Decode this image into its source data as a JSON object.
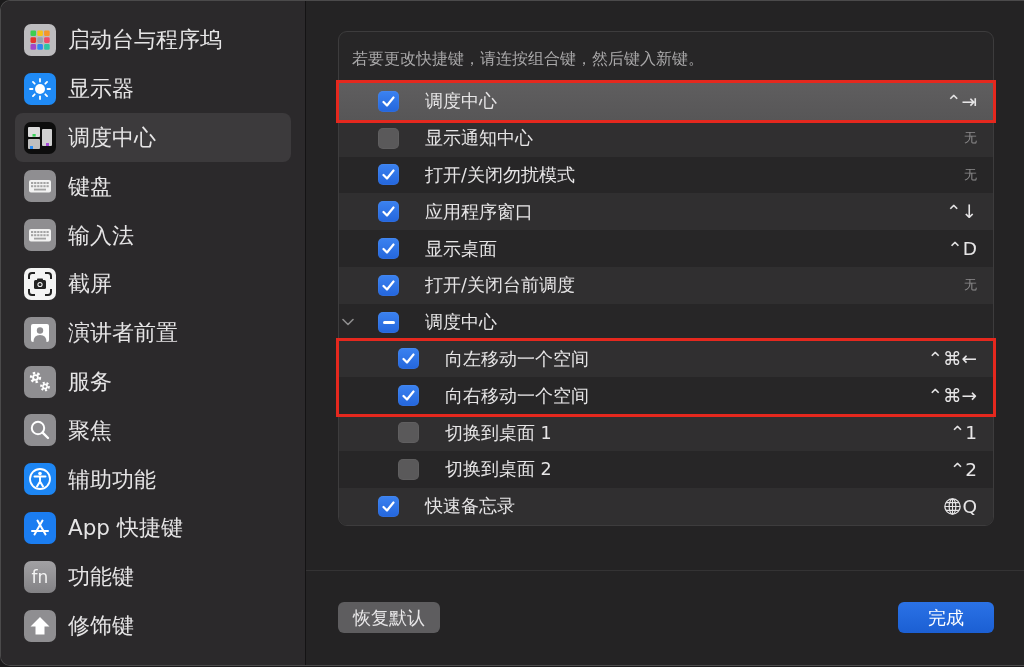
{
  "sidebar": {
    "items": [
      {
        "label": "启动台与程序坞",
        "selected": false
      },
      {
        "label": "显示器",
        "selected": false
      },
      {
        "label": "调度中心",
        "selected": true
      },
      {
        "label": "键盘",
        "selected": false
      },
      {
        "label": "输入法",
        "selected": false
      },
      {
        "label": "截屏",
        "selected": false
      },
      {
        "label": "演讲者前置",
        "selected": false
      },
      {
        "label": "服务",
        "selected": false
      },
      {
        "label": "聚焦",
        "selected": false
      },
      {
        "label": "辅助功能",
        "selected": false
      },
      {
        "label": "App 快捷键",
        "selected": false
      },
      {
        "label": "功能键",
        "selected": false,
        "icon_label": "fn"
      },
      {
        "label": "修饰键",
        "selected": false
      }
    ]
  },
  "shortcuts_panel": {
    "hint": "若要更改快捷键，请连按组合键，然后键入新键。",
    "items": [
      {
        "label": "调度中心",
        "checked": true,
        "selected": true,
        "annotated": true,
        "shortcut": "⌃⇥",
        "shortcut_assigned": true
      },
      {
        "label": "显示通知中心",
        "checked": false,
        "selected": false,
        "annotated": false,
        "shortcut": "无",
        "shortcut_assigned": false
      },
      {
        "label": "打开/关闭勿扰模式",
        "checked": true,
        "selected": false,
        "annotated": false,
        "shortcut": "无",
        "shortcut_assigned": false
      },
      {
        "label": "应用程序窗口",
        "checked": true,
        "selected": false,
        "annotated": false,
        "shortcut": "⌃↓",
        "shortcut_assigned": true
      },
      {
        "label": "显示桌面",
        "checked": true,
        "selected": false,
        "annotated": false,
        "shortcut": "⌃D",
        "shortcut_assigned": true
      },
      {
        "label": "打开/关闭台前调度",
        "checked": true,
        "selected": false,
        "annotated": false,
        "shortcut": "无",
        "shortcut_assigned": false
      },
      {
        "label": "调度中心",
        "mixed": true,
        "selected": false,
        "annotated": false,
        "expanded": true,
        "children": [
          {
            "label": "向左移动一个空间",
            "checked": true,
            "selected": false,
            "annotated": true,
            "shortcut": "⌃⌘←",
            "shortcut_assigned": true
          },
          {
            "label": "向右移动一个空间",
            "checked": true,
            "selected": false,
            "annotated": true,
            "shortcut": "⌃⌘→",
            "shortcut_assigned": true
          },
          {
            "label": "切换到桌面 1",
            "checked": false,
            "selected": false,
            "annotated": false,
            "shortcut": "⌃1",
            "shortcut_assigned": true
          },
          {
            "label": "切换到桌面 2",
            "checked": false,
            "selected": false,
            "annotated": false,
            "shortcut": "⌃2",
            "shortcut_assigned": true
          }
        ]
      },
      {
        "label": "快速备忘录",
        "checked": true,
        "selected": false,
        "annotated": false,
        "shortcut": "Q",
        "shortcut_assigned": true,
        "globe_key": true
      }
    ]
  },
  "buttons": [
    {
      "label": "恢复默认",
      "kind": "secondary"
    },
    {
      "label": "完成",
      "kind": "primary"
    }
  ]
}
